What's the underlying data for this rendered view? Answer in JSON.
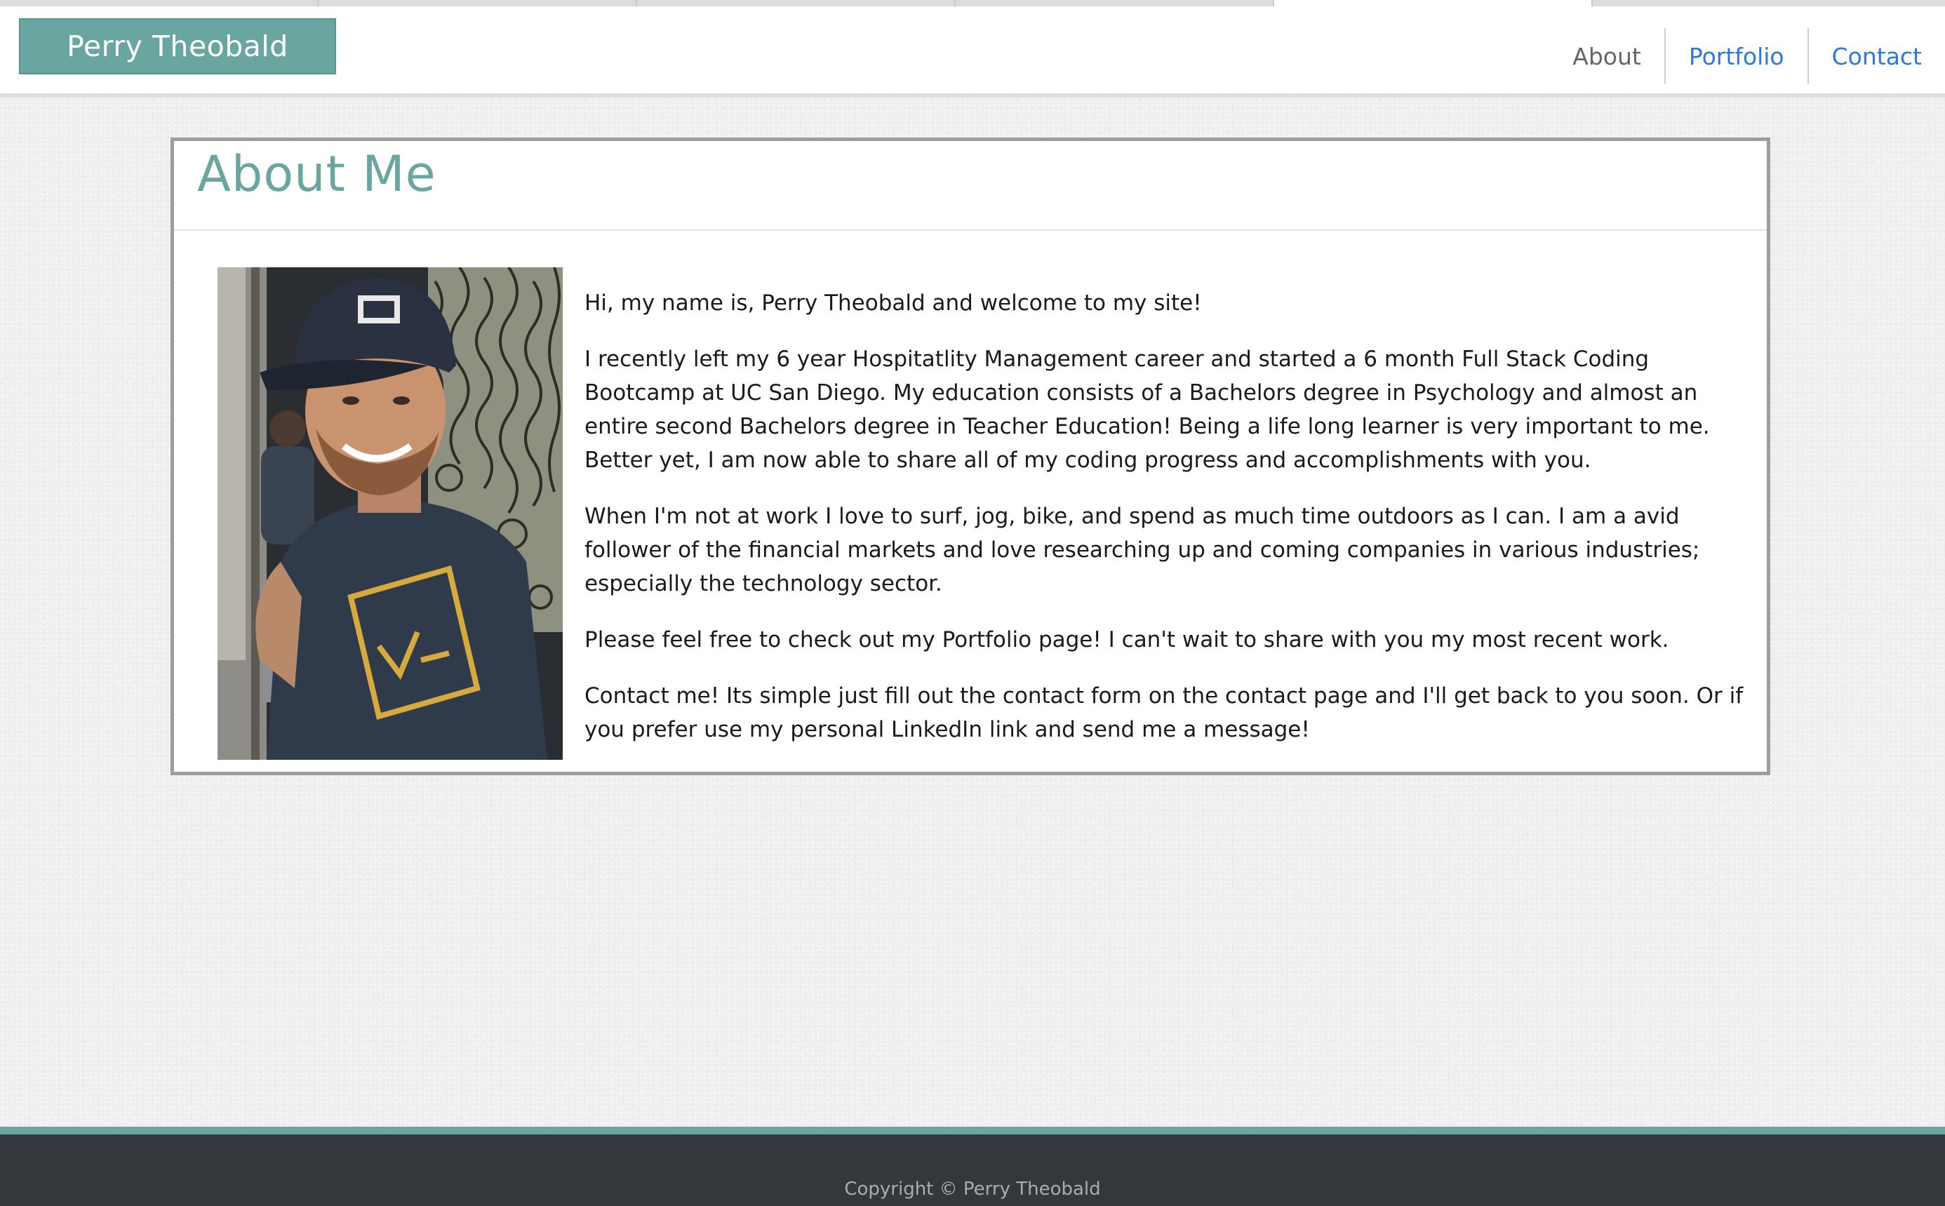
{
  "brand": {
    "name": "Perry Theobald"
  },
  "nav": {
    "items": [
      {
        "label": "About",
        "active": true
      },
      {
        "label": "Portfolio",
        "active": false
      },
      {
        "label": "Contact",
        "active": false
      }
    ]
  },
  "about": {
    "title": "About Me",
    "photo_icon": "portrait-photo-icon",
    "paragraphs": [
      "Hi, my name is, Perry Theobald and welcome to my site!",
      "I recently left my 6 year Hospitatlity Management career and started a 6 month Full Stack Coding Bootcamp at UC San Diego. My education consists of a Bachelors degree in Psychology and almost an entire second Bachelors degree in Teacher Education! Being a life long learner is very important to me. Better yet, I am now able to share all of my coding progress and accomplishments with you.",
      "When I'm not at work I love to surf, jog, bike, and spend as much time outdoors as I can. I am a avid follower of the financial markets and love researching up and coming companies in various industries; especially the technology sector.",
      "Please feel free to check out my Portfolio page! I can't wait to share with you my most recent work.",
      "Contact me! Its simple just fill out the contact form on the contact page and I'll get back to you soon. Or if you prefer use my personal LinkedIn link and send me a message!"
    ]
  },
  "footer": {
    "copyright": "Copyright © Perry Theobald"
  },
  "colors": {
    "accent": "#69a6a0",
    "link": "#2f78d8",
    "footer_bg": "#33383c",
    "page_bg": "#efefef"
  }
}
